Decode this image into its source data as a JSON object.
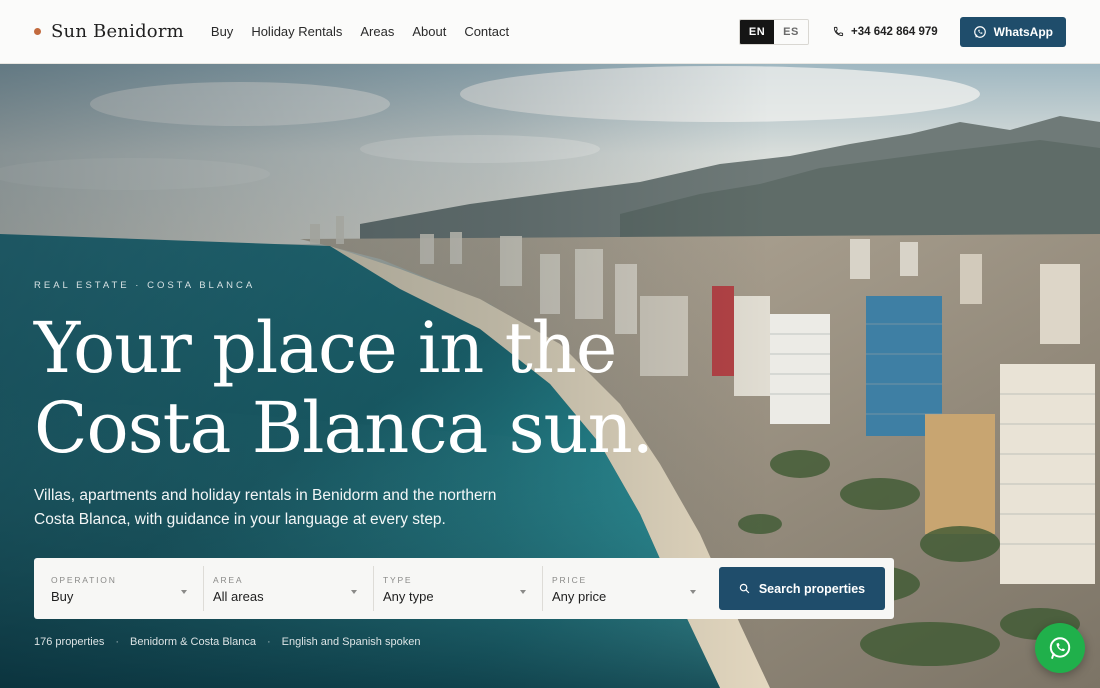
{
  "brand": {
    "name": "Sun Benidorm",
    "dot_color": "#c26a3e"
  },
  "nav": {
    "items": [
      "Buy",
      "Holiday Rentals",
      "Areas",
      "About",
      "Contact"
    ]
  },
  "language": {
    "options": [
      "EN",
      "ES"
    ],
    "active": "EN"
  },
  "contact": {
    "phone": "+34 642 864 979",
    "phone_icon": "phone-icon",
    "whatsapp_label": "WhatsApp",
    "whatsapp_icon": "whatsapp-icon"
  },
  "hero": {
    "eyebrow": "REAL ESTATE · COSTA BLANCA",
    "headline_line1": "Your place in the",
    "headline_line2": "Costa Blanca sun.",
    "subtitle": "Villas, apartments and holiday rentals in Benidorm and the northern Costa Blanca, with guidance in your language at every step."
  },
  "search": {
    "fields": [
      {
        "label": "OPERATION",
        "value": "Buy"
      },
      {
        "label": "AREA",
        "value": "All areas"
      },
      {
        "label": "TYPE",
        "value": "Any type"
      },
      {
        "label": "PRICE",
        "value": "Any price"
      }
    ],
    "button_label": "Search properties",
    "button_icon": "search-icon"
  },
  "stats": [
    "176 properties",
    "Benidorm & Costa Blanca",
    "English and Spanish spoken"
  ],
  "colors": {
    "accent": "#1f4d6b",
    "whatsapp_green": "#20b04b"
  }
}
